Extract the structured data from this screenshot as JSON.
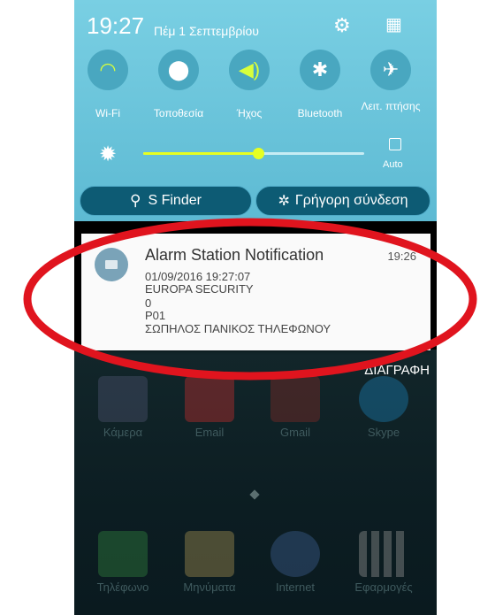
{
  "status_bar": {
    "time": "19:27",
    "date": "Πέμ 1 Σεπτεμβρίου"
  },
  "quick_settings": [
    {
      "label": "Wi-Fi",
      "icon": "wifi-icon",
      "active": true
    },
    {
      "label": "Τοποθεσία",
      "icon": "location-icon",
      "active": false
    },
    {
      "label": "Ήχος",
      "icon": "sound-icon",
      "active": true
    },
    {
      "label": "Bluetooth",
      "icon": "bluetooth-icon",
      "active": false
    },
    {
      "label": "Λειτ. πτήσης",
      "icon": "airplane-icon",
      "active": false
    }
  ],
  "brightness": {
    "level": 0.52,
    "auto_label": "Auto"
  },
  "buttons": {
    "sfinder": "S Finder",
    "quick_connect": "Γρήγορη σύνδεση"
  },
  "notification": {
    "title": "Alarm Station Notification",
    "time": "19:26",
    "lines": [
      "01/09/2016 19:27:07",
      "EUROPA SECURITY",
      "0",
      "P01",
      "ΣΩΠΗΛΟΣ ΠΑΝΙΚΟΣ ΤΗΛΕΦΩΝΟΥ"
    ]
  },
  "clear_label": "ΔΙΑΓΡΑΦΗ",
  "home_apps": [
    {
      "label": "Κάμερα",
      "icon": "camera-icon"
    },
    {
      "label": "Email",
      "icon": "email-icon"
    },
    {
      "label": "Gmail",
      "icon": "gmail-icon"
    },
    {
      "label": "Skype",
      "icon": "skype-icon"
    },
    {
      "label": "Τηλέφωνο",
      "icon": "phone-icon"
    },
    {
      "label": "Μηνύματα",
      "icon": "messages-icon"
    },
    {
      "label": "Internet",
      "icon": "internet-icon"
    },
    {
      "label": "Εφαρμογές",
      "icon": "apps-icon"
    }
  ],
  "colors": {
    "panel": "#6cc6dc",
    "annotation": "#e0141e",
    "accent": "#e6ff21"
  }
}
